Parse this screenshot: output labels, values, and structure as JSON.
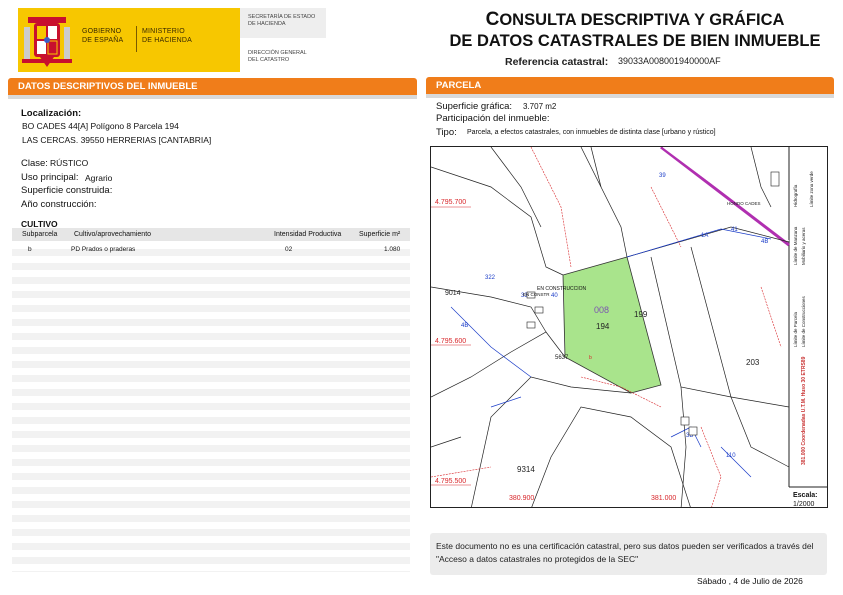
{
  "header": {
    "gov_line1": "GOBIERNO",
    "gov_line2": "DE ESPAÑA",
    "min_line1": "MINISTERIO",
    "min_line2": "DE HACIENDA",
    "sec_line1": "SECRETARÍA DE ESTADO",
    "sec_line2": "DE HACIENDA",
    "dg_line1": "DIRECCIÓN GENERAL",
    "dg_line2": "DEL CATASTRO",
    "title_line1_cap": "C",
    "title_line1_rest": "ONSULTA DESCRIPTIVA Y GRÁFICA",
    "title_line2": "DE DATOS CATASTRALES DE BIEN INMUEBLE",
    "refcat_label": "Referencia catastral:",
    "refcat_value": "39033A008001940000AF"
  },
  "left": {
    "section_title": "DATOS DESCRIPTIVOS DEL INMUEBLE",
    "localizacion_label": "Localización:",
    "localizacion_line1": "BO CADES 44[A] Polígono 8 Parcela 194",
    "localizacion_line2": "LAS CERCAS. 39550 HERRERIAS [CANTABRIA]",
    "clase_label": "Clase:",
    "clase_value": "RÚSTICO",
    "uso_label": "Uso principal:",
    "uso_value": "Agrario",
    "superficie_label": "Superficie construida:",
    "anio_label": "Año construcción:",
    "cultivo_title": "CULTIVO",
    "table": {
      "headers": [
        "Subparcela",
        "Cultivo/aprovechamiento",
        "Intensidad Productiva",
        "Superficie m²"
      ],
      "rows": [
        [
          "b",
          "PD Prados o praderas",
          "02",
          "1.080"
        ]
      ]
    }
  },
  "right": {
    "section_title": "PARCELA",
    "superficie_label": "Superficie gráfica:",
    "superficie_value": "3.707 m2",
    "participacion_label": "Participación del inmueble:",
    "tipo_label": "Tipo:",
    "tipo_value": "Parcela, a efectos catastrales, con inmuebles de distinta clase [urbano y rústico]",
    "map": {
      "coord_y1": "4.795.700",
      "coord_y2": "4.795.600",
      "coord_y3": "4.795.500",
      "coord_x1": "380.900",
      "coord_x2": "381.000",
      "parcel_number": "008",
      "parcel_id": "194",
      "label_199": "199",
      "label_203": "203",
      "label_9314": "9314",
      "label_9014": "9014",
      "label_en_construccion": "EN CONSTRUCCION",
      "label_en_constr2": "EN CONSTR",
      "label_b": "b",
      "label_sub": "5637",
      "label_hondo": "HONDO CADES",
      "legend_1": "Límite de Manzana",
      "legend_2": "Límite de Parcela",
      "legend_3": "Límite de Construcciones",
      "legend_4": "Mobiliario y aceras",
      "legend_5": "Límite zona verde",
      "legend_6": "Hidrografía",
      "legend_coords": "381.000 Coordenadas U.T.M. Huso 30 ETRS89",
      "scale_label": "Escala:",
      "scale_value": "1/2000"
    },
    "note": "Este documento no es una certificación catastral, pero sus datos pueden ser verificados a través del \"Acceso a datos catastrales no protegidos de la SEC\"",
    "date": "Sábado , 4 de Julio de 2026"
  },
  "colors": {
    "orange": "#f07d1a",
    "yellow": "#f7c700",
    "parcel_green": "#a9e48c",
    "blue_line": "#1a3cc8",
    "red_line": "#d8262a",
    "magenta": "#b02fb0"
  }
}
